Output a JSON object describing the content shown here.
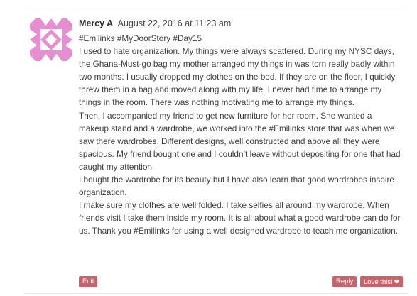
{
  "comment": {
    "author": "Mercy A",
    "date": "August 22, 2016 at 11:23 am",
    "paragraphs": [
      "#Emilinks #MyDoorStory #Day15",
      "I used to hate organization. My things were always scattered. During my NYSC days, the Ghana-Must-go bag my mother arranged my things in was torn really badly within two months. I usually dropped my clothes on the bed. If they are on the floor, I quickly threw them in a bag and moved along with my life. I never had time to arrange my things in the room. There was nothing motivating me to arrange my things.",
      "Then, I accompanied my friend to get new furniture for her room, She wanted a makeup stand and a wardrobe, we worked into the #Emilinks store that was when we saw there wardrobes. Different designs, well constructed and above all they were spacious. My friend bought one and I couldn’t leave without depositing for one that had caught my attention.",
      "I bought the wardrobe for its beauty but I have also learn that good wardrobes inspire organization.",
      "I make sure my clothes are well folded. I take selfies all around my wardrobe. When friends visit I take them inside my room. It is all about what a good wardrobe can do for us. Thank you #Emilinks for using a well designed wardrobe to teach me organization."
    ]
  },
  "actions": {
    "edit_label": "Edit",
    "reply_label": "Reply",
    "love_label": "Love this!"
  },
  "colors": {
    "button": "#c9636b",
    "avatar_pink": "#e58fd0"
  },
  "icons": {
    "love": "heart-icon",
    "avatar": "identicon-avatar"
  }
}
